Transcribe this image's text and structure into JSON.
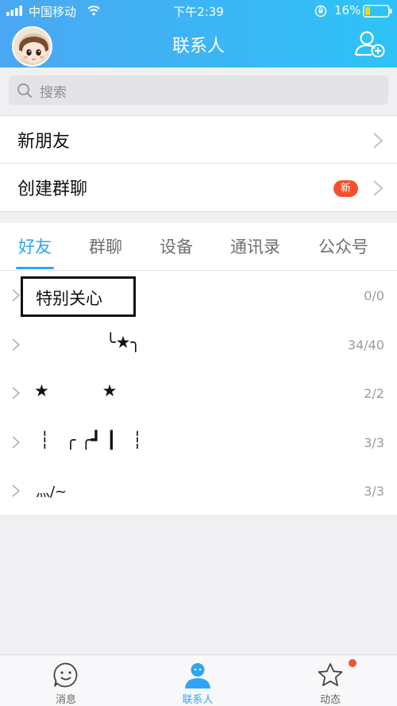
{
  "status_bar": {
    "carrier": "中国移动",
    "time": "下午2:39",
    "battery": "16%"
  },
  "header": {
    "title": "联系人"
  },
  "search": {
    "placeholder": "搜索"
  },
  "menu": {
    "new_friends": "新朋友",
    "group_chat": "创建群聊",
    "new_badge": "新"
  },
  "tabs": [
    {
      "label": "好友"
    },
    {
      "label": "群聊"
    },
    {
      "label": "设备"
    },
    {
      "label": "通讯录"
    },
    {
      "label": "公众号"
    }
  ],
  "groups": [
    {
      "name": "特别关心",
      "count": "0/0"
    },
    {
      "name": "╰★╮",
      "count": "34/40"
    },
    {
      "name": "★          ★",
      "count": "2/2"
    },
    {
      "name": "┆   ╭ ╭┛ ┃   ┆",
      "count": "3/3"
    },
    {
      "name": "灬/~",
      "count": "3/3"
    }
  ],
  "tabbar": {
    "messages": "消息",
    "contacts": "联系人",
    "feeds": "动态"
  },
  "colors": {
    "accent": "#2ea6f3",
    "header_start": "#4ba7f2",
    "header_end": "#2ec3f7",
    "badge": "#f5502b"
  }
}
